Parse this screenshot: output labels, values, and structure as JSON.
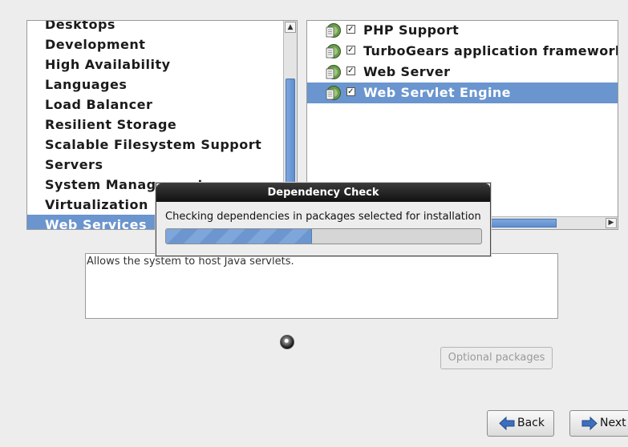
{
  "categories": {
    "items": [
      {
        "label": "Desktops",
        "selected": false
      },
      {
        "label": "Development",
        "selected": false
      },
      {
        "label": "High Availability",
        "selected": false
      },
      {
        "label": "Languages",
        "selected": false
      },
      {
        "label": "Load Balancer",
        "selected": false
      },
      {
        "label": "Resilient Storage",
        "selected": false
      },
      {
        "label": "Scalable Filesystem Support",
        "selected": false
      },
      {
        "label": "Servers",
        "selected": false
      },
      {
        "label": "System Management",
        "selected": false
      },
      {
        "label": "Virtualization",
        "selected": false
      },
      {
        "label": "Web Services",
        "selected": true
      }
    ]
  },
  "packages": {
    "items": [
      {
        "label": "PHP Support",
        "checked": true,
        "selected": false,
        "icon": "package-group-icon"
      },
      {
        "label": "TurboGears application framework",
        "checked": true,
        "selected": false,
        "icon": "package-group-icon"
      },
      {
        "label": "Web Server",
        "checked": true,
        "selected": false,
        "icon": "package-group-icon"
      },
      {
        "label": "Web Servlet Engine",
        "checked": true,
        "selected": true,
        "icon": "package-group-icon"
      }
    ]
  },
  "description": "Allows the system to host Java servlets.",
  "optional_packages_label": "Optional packages",
  "back_label": "Back",
  "next_label": "Next",
  "dialog": {
    "title": "Dependency Check",
    "message": "Checking dependencies in packages selected for installation",
    "progress": 0.46
  },
  "colors": {
    "selection": "#6a95cf",
    "window_bg": "#ededed",
    "dialog_title_bg": "#1a1a1a"
  }
}
